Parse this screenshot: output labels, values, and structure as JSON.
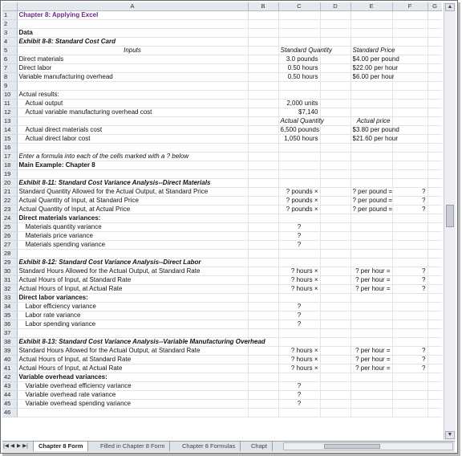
{
  "columns": [
    "A",
    "B",
    "C",
    "D",
    "E",
    "F",
    "G"
  ],
  "rows": [
    {
      "n": "1",
      "a": "Chapter 8: Applying Excel"
    },
    {
      "n": "2"
    },
    {
      "n": "3",
      "a": "Data"
    },
    {
      "n": "4",
      "a": "Exhibit 8-8: Standard Cost Card"
    },
    {
      "n": "5",
      "a": "Inputs",
      "c": "Standard Quantity",
      "e": "Standard Price"
    },
    {
      "n": "6",
      "a": "Direct materials",
      "c": "3.0 pounds",
      "e": "$4.00 per pound"
    },
    {
      "n": "7",
      "a": "Direct labor",
      "c": "0.50 hours",
      "e": "$22.00 per hour"
    },
    {
      "n": "8",
      "a": "Variable manufacturing overhead",
      "c": "0.50 hours",
      "e": "$6.00 per hour"
    },
    {
      "n": "9"
    },
    {
      "n": "10",
      "a": "Actual results:"
    },
    {
      "n": "11",
      "a": "Actual output",
      "c": "2,000 units"
    },
    {
      "n": "12",
      "a": "Actual variable manufacturing overhead cost",
      "c": "$7,140"
    },
    {
      "n": "13",
      "c": "Actual Quantity",
      "e": "Actual price"
    },
    {
      "n": "14",
      "a": "Actual direct materials cost",
      "c": "6,500 pounds",
      "e": "$3.80 per pound"
    },
    {
      "n": "15",
      "a": "Actual direct labor cost",
      "c": "1,050 hours",
      "e": "$21.60 per hour"
    },
    {
      "n": "16"
    },
    {
      "n": "17",
      "a": "Enter a formula into each of the cells marked with a ? below"
    },
    {
      "n": "18",
      "a": "Main Example: Chapter 8"
    },
    {
      "n": "19"
    },
    {
      "n": "20",
      "a": "Exhibit 8-11: Standard Cost Variance Analysis--Direct Materials"
    },
    {
      "n": "21",
      "a": "Standard Quantity Allowed for the Actual Output, at Standard Price",
      "c": "? pounds ×",
      "e": "? per pound =",
      "f": "?"
    },
    {
      "n": "22",
      "a": "Actual Quantity of Input, at Standard Price",
      "c": "? pounds ×",
      "e": "? per pound =",
      "f": "?"
    },
    {
      "n": "23",
      "a": "Actual Quantity of Input, at Actual Price",
      "c": "? pounds ×",
      "e": "? per pound =",
      "f": "?"
    },
    {
      "n": "24",
      "a": "Direct materials variances:"
    },
    {
      "n": "25",
      "a": "Materials quantity variance",
      "c": "?"
    },
    {
      "n": "26",
      "a": "Materials price variance",
      "c": "?"
    },
    {
      "n": "27",
      "a": "Materials spending variance",
      "c": "?"
    },
    {
      "n": "28"
    },
    {
      "n": "29",
      "a": "Exhibit 8-12: Standard Cost Variance Analysis--Direct Labor"
    },
    {
      "n": "30",
      "a": "Standard Hours Allowed for the Actual Output, at Standard Rate",
      "c": "? hours ×",
      "e": "? per hour =",
      "f": "?"
    },
    {
      "n": "31",
      "a": "Actual Hours of Input, at Standard Rate",
      "c": "? hours ×",
      "e": "? per hour =",
      "f": "?"
    },
    {
      "n": "32",
      "a": "Actual Hours of Input, at Actual Rate",
      "c": "? hours ×",
      "e": "? per hour =",
      "f": "?"
    },
    {
      "n": "33",
      "a": "Direct labor variances:"
    },
    {
      "n": "34",
      "a": "Labor efficiency variance",
      "c": "?"
    },
    {
      "n": "35",
      "a": "Labor rate variance",
      "c": "?"
    },
    {
      "n": "36",
      "a": "Labor spending variance",
      "c": "?"
    },
    {
      "n": "37"
    },
    {
      "n": "38",
      "a": "Exhibit 8-13: Standard Cost Variance Analysis--Variable Manufacturing Overhead"
    },
    {
      "n": "39",
      "a": "Standard Hours Allowed for the Actual Output, at Standard Rate",
      "c": "? hours ×",
      "e": "? per hour =",
      "f": "?"
    },
    {
      "n": "40",
      "a": "Actual Hours of Input, at Standard Rate",
      "c": "? hours ×",
      "e": "? per hour =",
      "f": "?"
    },
    {
      "n": "41",
      "a": "Actual Hours of Input, at Actual Rate",
      "c": "? hours ×",
      "e": "? per hour =",
      "f": "?"
    },
    {
      "n": "42",
      "a": "Variable overhead variances:"
    },
    {
      "n": "43",
      "a": "Variable overhead efficiency variance",
      "c": "?"
    },
    {
      "n": "44",
      "a": "Variable overhead rate variance",
      "c": "?"
    },
    {
      "n": "45",
      "a": "Variable overhead spending variance",
      "c": "?"
    },
    {
      "n": "46"
    }
  ],
  "tabs": [
    {
      "label": "Chapter 8 Form",
      "active": true
    },
    {
      "label": "Filled in Chapter 8 Form",
      "active": false
    },
    {
      "label": "Chapter 8 Formulas",
      "active": false
    },
    {
      "label": "Chapt",
      "active": false
    }
  ],
  "nav": {
    "first": "|◀",
    "prev": "◀",
    "next": "▶",
    "last": "▶|"
  },
  "colors": {
    "title": "#6b2a86",
    "header_bg": "#e4e8ef",
    "gridline": "#e4e4e4"
  }
}
